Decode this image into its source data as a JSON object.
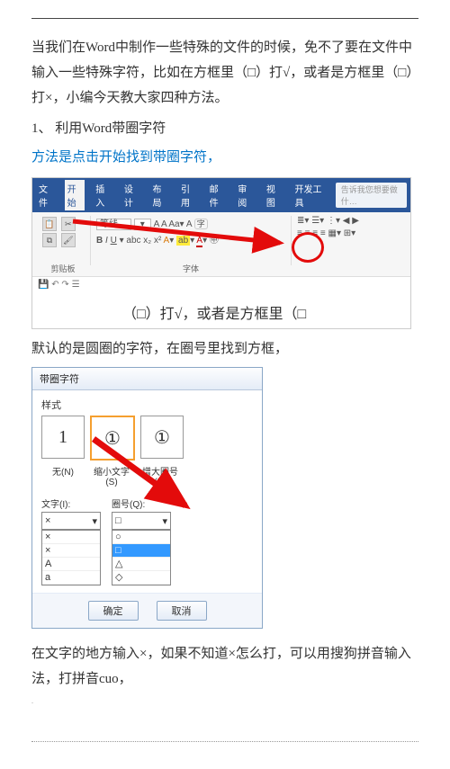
{
  "para1": "当我们在Word中制作一些特殊的文件的时候，免不了要在文件中输入一些特殊字符，比如在方框里（□）打√，或者是方框里（□）打×，小编今天教大家四种方法。",
  "item1": "1、 利用Word带圈字符",
  "line1": "方法是点击开始找到带圈字符，",
  "ribbon": {
    "tabs": [
      "文件",
      "开始",
      "插入",
      "设计",
      "布局",
      "引用",
      "邮件",
      "审阅",
      "视图",
      "开发工具"
    ],
    "active_tab": "开始",
    "help_placeholder": "告诉我您想要做什…",
    "group_clipboard": "剪贴板",
    "group_font": "字体",
    "sample_text": "（□）打√，或者是方框里（□",
    "qat_icons": [
      "💾",
      "↶",
      "↷",
      "☰"
    ]
  },
  "para2": "默认的是圆圈的字符，在圈号里找到方框，",
  "dialog": {
    "title": "带圈字符",
    "style_label": "样式",
    "option_none": "无(N)",
    "option_shrink": "缩小文字(S)",
    "option_enlarge": "增大圈号(E)",
    "sample_none": "1",
    "sample_shrink": "①",
    "sample_enlarge": "①",
    "text_label": "文字(I):",
    "ring_label": "圈号(Q):",
    "text_value": "×",
    "text_options": [
      "×",
      "×",
      "A",
      "a"
    ],
    "ring_value": "□",
    "ring_options": [
      "○",
      "□",
      "△",
      "◇"
    ],
    "ok": "确定",
    "cancel": "取消"
  },
  "para3": "在文字的地方输入×，如果不知道×怎么打，可以用搜狗拼音输入法，打拼音cuo，"
}
